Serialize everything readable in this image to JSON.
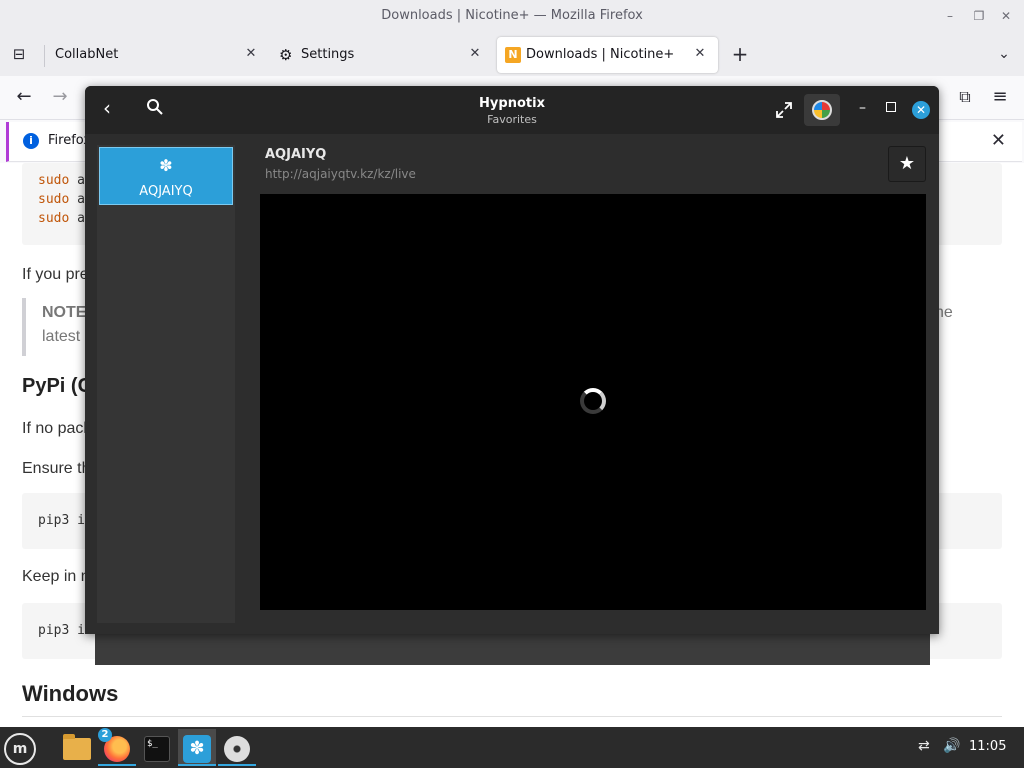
{
  "firefox": {
    "window_title": "Downloads | Nicotine+ — Mozilla Firefox",
    "tabs": [
      {
        "label": "CollabNet"
      },
      {
        "label": "Settings"
      },
      {
        "label": "Downloads | Nicotine+"
      }
    ],
    "notice_text": "Firefox"
  },
  "page": {
    "code1": [
      {
        "cmd": "sudo",
        "rest": " a"
      },
      {
        "cmd": "sudo",
        "rest": " a"
      },
      {
        "cmd": "sudo",
        "rest": " a"
      }
    ],
    "para1": "If you pre",
    "note_label": "NOTE",
    "note_line2": "latest",
    "note_trail": "he",
    "heading_pypi": "PyPi (C",
    "para2": "If no pack",
    "para3": "Ensure th",
    "code2": "pip3 i",
    "para4": "Keep in m",
    "code3": "pip3 i",
    "heading_windows": "Windows"
  },
  "hypnotix": {
    "title": "Hypnotix",
    "subtitle": "Favorites",
    "channels": [
      {
        "label": "AQJAIYQ"
      }
    ],
    "current_channel": {
      "name": "AQJAIYQ",
      "url": "http://aqjaiyqtv.kz/kz/live"
    }
  },
  "taskbar": {
    "firefox_badge": "2",
    "terminal_prompt": "$_",
    "clock": "11:05"
  }
}
